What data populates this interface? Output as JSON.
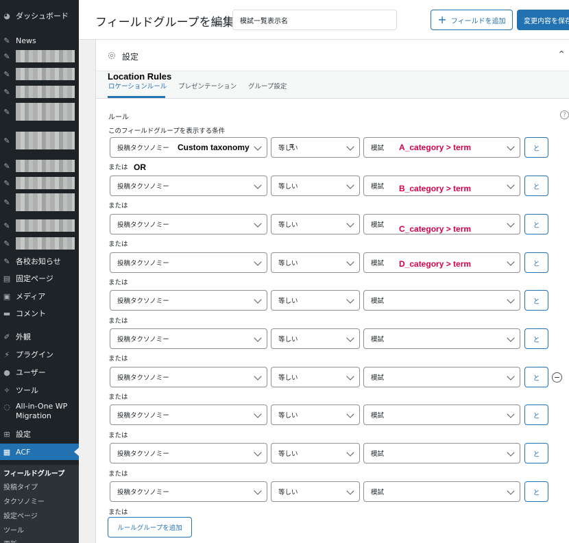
{
  "sidebar": {
    "dashboard": "ダッシュボード",
    "news": "News",
    "notice": "各校お知らせ",
    "pages": "固定ページ",
    "media": "メディア",
    "comments": "コメント",
    "appearance": "外観",
    "plugins": "プラグイン",
    "users": "ユーザー",
    "tools": "ツール",
    "migration": "All-in-One WP Migration",
    "settings": "設定",
    "acf": "ACF",
    "submenu": [
      "フィールドグループ",
      "投稿タイプ",
      "タクソノミー",
      "設定ページ",
      "ツール",
      "更新"
    ]
  },
  "header": {
    "title": "フィールドグループを編集",
    "title_input_value": "模試一覧表示名",
    "add_field": "フィールドを追加",
    "save": "変更内容を保存"
  },
  "settings": {
    "title": "設定",
    "annotation": "Location Rules",
    "tabs": [
      "ロケーションルール",
      "プレゼンテーション",
      "グループ設定"
    ],
    "rules_label": "ルール",
    "help": "?",
    "condition_label": "このフィールドグループを表示する条件",
    "or_label": "または",
    "and_label": "と",
    "remove": "−",
    "add_rule_group": "ルールグループを追加"
  },
  "rules": [
    {
      "param": "投稿タクソノミー",
      "operator": "等しい",
      "value": "模試"
    },
    {
      "param": "投稿タクソノミー",
      "operator": "等しい",
      "value": "模試"
    },
    {
      "param": "投稿タクソノミー",
      "operator": "等しい",
      "value": "模試"
    },
    {
      "param": "投稿タクソノミー",
      "operator": "等しい",
      "value": "模試"
    },
    {
      "param": "投稿タクソノミー",
      "operator": "等しい",
      "value": "模試"
    },
    {
      "param": "投稿タクソノミー",
      "operator": "等しい",
      "value": "模試"
    },
    {
      "param": "投稿タクソノミー",
      "operator": "等しい",
      "value": "模試"
    },
    {
      "param": "投稿タクソノミー",
      "operator": "等しい",
      "value": "模試"
    },
    {
      "param": "投稿タクソノミー",
      "operator": "等しい",
      "value": "模試"
    },
    {
      "param": "投稿タクソノミー",
      "operator": "等しい",
      "value": "模試"
    }
  ],
  "annotations": {
    "custom_taxonomy": "Custom taxonomy",
    "equals": "=",
    "or": "OR",
    "a": "A_category > term",
    "b": "B_category > term",
    "c": "C_category > term",
    "d": "D_category > term"
  },
  "colors": {
    "sidebar": "#1d2327",
    "accent": "#2271b1",
    "annotation_red": "#d6004c"
  }
}
